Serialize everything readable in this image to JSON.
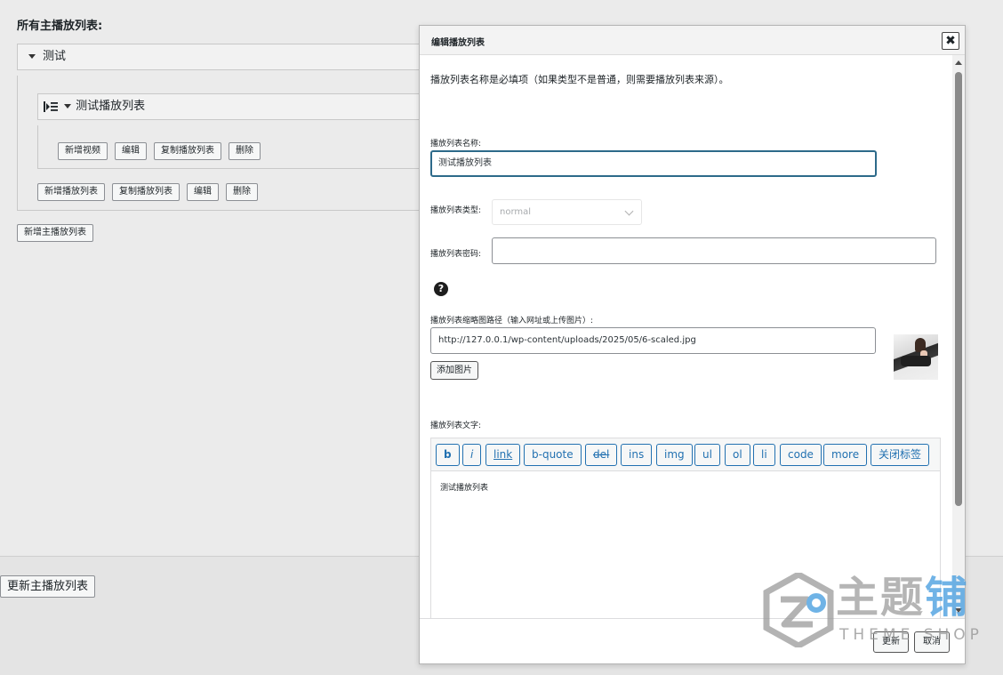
{
  "background": {
    "page_title": "所有主播放列表:",
    "master_playlist_name": "测试",
    "playlist_name": "测试播放列表",
    "playlist_buttons": {
      "add_video": "新增视频",
      "edit": "编辑",
      "copy_playlist": "复制播放列表",
      "delete": "删除"
    },
    "master_buttons": {
      "add_playlist": "新增播放列表",
      "copy_playlist": "复制播放列表",
      "edit": "编辑",
      "delete": "删除"
    },
    "add_master_playlist": "新增主播放列表",
    "update_master_playlist": "更新主播放列表"
  },
  "modal": {
    "title": "编辑播放列表",
    "close_label": "✖",
    "intro": "播放列表名称是必填项（如果类型不是普通，则需要播放列表来源）。",
    "name_label": "播放列表名称:",
    "name_value": "测试播放列表",
    "type_label": "播放列表类型:",
    "type_value": "normal",
    "password_label": "播放列表密码:",
    "password_value": "",
    "help_symbol": "?",
    "thumb_label": "播放列表缩略图路径（输入网址或上传图片）:",
    "thumb_value": "http://127.0.0.1/wp-content/uploads/2025/05/6-scaled.jpg",
    "add_image": "添加图片",
    "text_label": "播放列表文字:",
    "toolbar": [
      "b",
      "i",
      "link",
      "b-quote",
      "del",
      "ins",
      "img",
      "ul",
      "ol",
      "li",
      "code",
      "more",
      "关闭标签"
    ],
    "editor_text": "测试播放列表",
    "update_button": "更新",
    "cancel_button": "取消"
  },
  "watermark": {
    "cn_gray": "主题",
    "cn_blue": "铺",
    "en": "THEME SHOP"
  },
  "colors": {
    "accent": "#2271b1",
    "focus_border": "#2d6a8a",
    "watermark_blue": "#409ade"
  }
}
